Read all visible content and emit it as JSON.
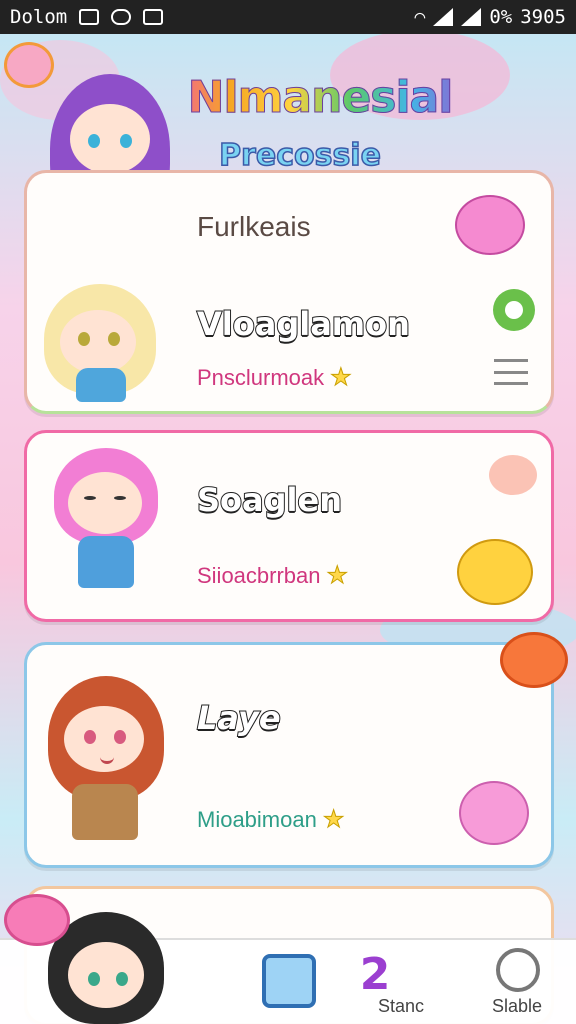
{
  "status_bar": {
    "carrier": "Dolom",
    "battery": "0%",
    "time": "3905"
  },
  "header": {
    "title": "Nlmanesial",
    "subtitle": "Precossie"
  },
  "cards": [
    {
      "top_label": "Furlkeais",
      "name": "Vloaglamon",
      "sub": "Pnsclurmoak"
    },
    {
      "name": "Soaglen",
      "sub": "Siioacbrrban"
    },
    {
      "name": "Laye",
      "sub": "Mioabimoan"
    }
  ],
  "bottom_nav": {
    "center_badge": "2",
    "item_1_label": "Stanc",
    "item_2_label": "Slable"
  },
  "colors": {
    "card_2_border": "#f06aa6",
    "card_3_border": "#8cc7e8",
    "sub_pink": "#d0377e",
    "sub_teal": "#2e9e88",
    "chat_green": "#6ac04a"
  }
}
